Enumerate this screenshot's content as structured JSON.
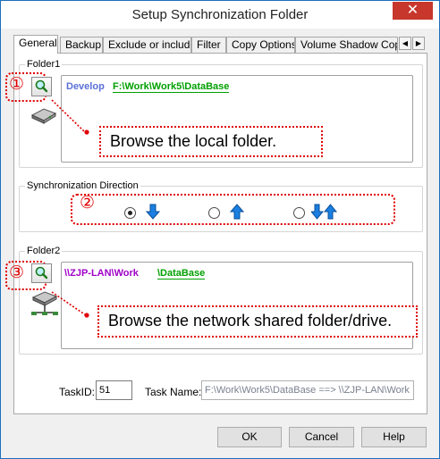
{
  "window": {
    "title": "Setup Synchronization Folder",
    "close_glyph": "✕"
  },
  "tabs": [
    "General",
    "Backup",
    "Exclude or include",
    "Filter",
    "Copy Options",
    "Volume Shadow Copy"
  ],
  "tab_scroll": {
    "left": "◀",
    "right": "▶"
  },
  "folder1": {
    "label": "Folder1",
    "marker": "①",
    "path_name": "Develop",
    "path_value": "F:\\Work\\Work5\\DataBase",
    "callout": "Browse the local folder."
  },
  "direction": {
    "label": "Synchronization Direction",
    "marker": "②",
    "selected_index": 0
  },
  "folder2": {
    "label": "Folder2",
    "marker": "③",
    "path_name": "\\\\ZJP-LAN\\Work",
    "path_value": "\\DataBase",
    "callout": "Browse the network shared folder/drive."
  },
  "task": {
    "id_label": "TaskID:",
    "id_value": "51",
    "name_label": "Task Name:",
    "name_value": "F:\\Work\\Work5\\DataBase ==> \\\\ZJP-LAN\\Work"
  },
  "buttons": {
    "ok": "OK",
    "cancel": "Cancel",
    "help": "Help"
  },
  "colors": {
    "accent_red": "#e00000",
    "local_path": "#00a000",
    "device_name": "#5a6fd6",
    "network_name": "#a000c8",
    "arrow_blue": "#1a7fe0"
  }
}
